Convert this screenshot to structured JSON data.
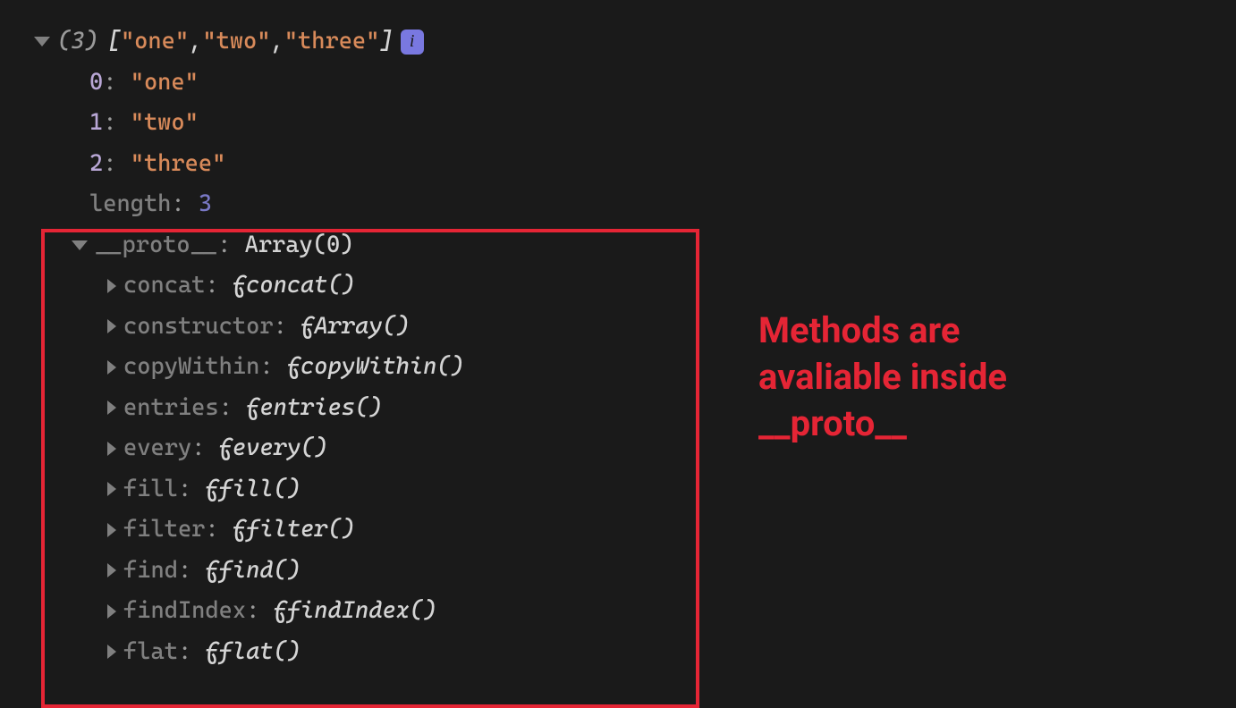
{
  "summary": {
    "count_label": "(3)",
    "open_bracket": "[",
    "close_bracket": "]",
    "items": [
      "\"one\"",
      "\"two\"",
      "\"three\""
    ],
    "sep": ", "
  },
  "info_glyph": "i",
  "entries": [
    {
      "index": "0",
      "value": "\"one\""
    },
    {
      "index": "1",
      "value": "\"two\""
    },
    {
      "index": "2",
      "value": "\"three\""
    }
  ],
  "length": {
    "label": "length",
    "value": "3"
  },
  "proto": {
    "label": "__proto__",
    "value": "Array(0)"
  },
  "methods": [
    {
      "name": "concat",
      "fn": "concat()"
    },
    {
      "name": "constructor",
      "fn": "Array()"
    },
    {
      "name": "copyWithin",
      "fn": "copyWithin()"
    },
    {
      "name": "entries",
      "fn": "entries()"
    },
    {
      "name": "every",
      "fn": "every()"
    },
    {
      "name": "fill",
      "fn": "fill()"
    },
    {
      "name": "filter",
      "fn": "filter()"
    },
    {
      "name": "find",
      "fn": "find()"
    },
    {
      "name": "findIndex",
      "fn": "findIndex()"
    },
    {
      "name": "flat",
      "fn": "flat()"
    }
  ],
  "fsymbol": "ƒ",
  "annotation": {
    "line1": "Methods are",
    "line2": "avaliable inside",
    "line3": "__proto__"
  },
  "colors": {
    "highlight": "#e52535",
    "background": "#1a1a1a"
  }
}
